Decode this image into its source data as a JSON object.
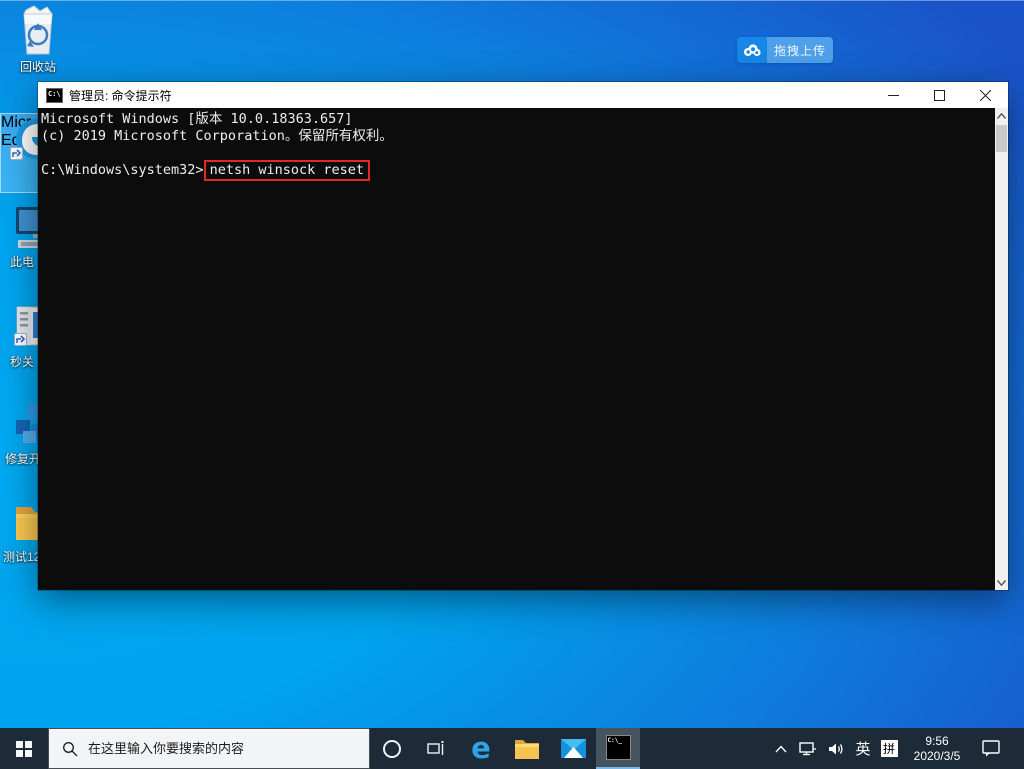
{
  "desktop": {
    "icons": [
      {
        "label": "回收站"
      },
      {
        "label_line1": "Micr",
        "label_line2": "Ed"
      },
      {
        "label": "此电"
      },
      {
        "label": "秒关"
      },
      {
        "label": "修复开"
      },
      {
        "label": "测试12"
      }
    ],
    "upload_button": {
      "label": "拖拽上传"
    }
  },
  "window": {
    "title": "管理员: 命令提示符",
    "title_icon_text": "C:\\",
    "console": {
      "line1": "Microsoft Windows [版本 10.0.18363.657]",
      "line2": "(c) 2019 Microsoft Corporation。保留所有权利。",
      "line3": "",
      "prompt": "C:\\Windows\\system32>",
      "command": "netsh winsock reset"
    }
  },
  "taskbar": {
    "search_placeholder": "在这里输入你要搜索的内容",
    "cmd_tile_text": "C:\\_",
    "tray": {
      "ime_language": "英",
      "ime_mode": "拼",
      "time": "9:56",
      "date": "2020/3/5"
    }
  },
  "colors": {
    "annotation_red": "#e22a20",
    "taskbar_bg": "#1d2a38",
    "active_underline": "#76b9ed",
    "upload_left_blue": "#1687e6",
    "upload_right_blue": "#4fa0ea",
    "desktop_cyan": "#00a9f1",
    "desktop_deep_blue": "#1a52c8"
  }
}
